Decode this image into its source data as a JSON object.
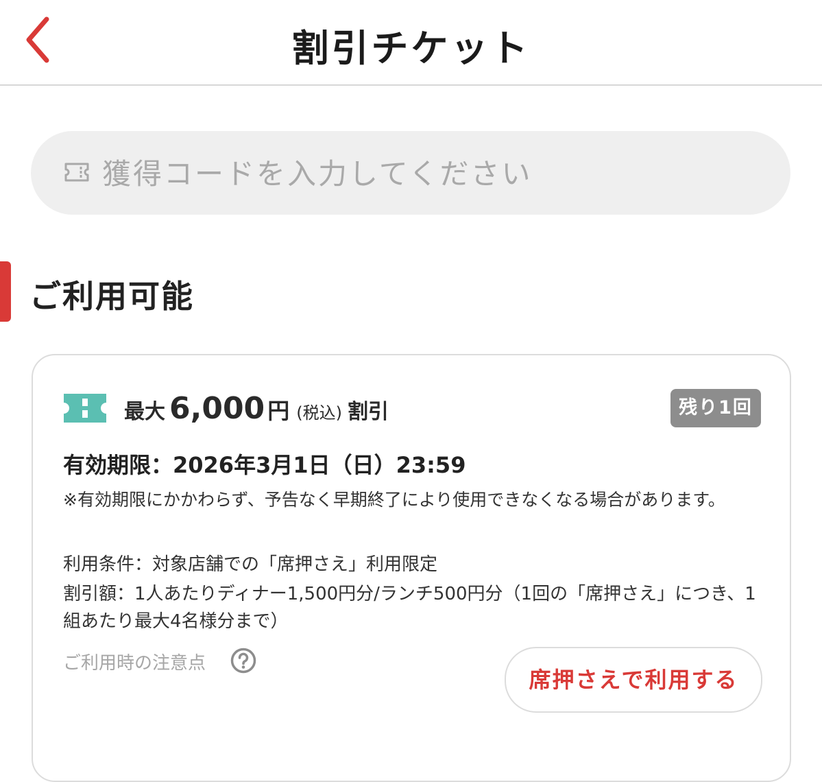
{
  "header": {
    "title": "割引チケット",
    "back_icon": "chevron-left-icon"
  },
  "code_input": {
    "placeholder": "獲得コードを入力してください",
    "value": "",
    "icon": "ticket-outline-icon"
  },
  "section": {
    "title": "ご利用可能"
  },
  "ticket": {
    "icon": "ticket-icon",
    "discount_prefix": "最大",
    "discount_amount": "6,000",
    "discount_unit": "円",
    "discount_tax": "(税込)",
    "discount_suffix": "割引",
    "remaining_badge": "残り1回",
    "expiry": "有効期限：2026年3月1日（日）23:59",
    "note": "※有効期限にかかわらず、予告なく早期終了により使用できなくなる場合があります。",
    "condition_usage": "利用条件：対象店舗での「席押さえ」利用限定",
    "condition_amount": "割引額：1人あたりディナー1,500円分/ランチ500円分（1回の「席押さえ」につき、1組あたり最大4名様分まで）",
    "caution_link": "ご利用時の注意点",
    "help_icon": "question-circle-icon",
    "use_button": "席押さえで利用する"
  },
  "colors": {
    "accent": "#d93a37",
    "ticket": "#5bbfb2",
    "badge": "#8d8d8d",
    "input_bg": "#efefef"
  }
}
